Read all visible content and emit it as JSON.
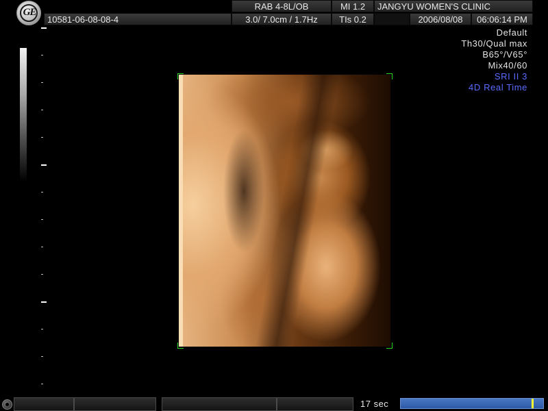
{
  "header": {
    "logo": "GE",
    "patient_id": "10581-06-08-08-4",
    "probe": "RAB 4-8L/OB",
    "depth_freq": "3.0/ 7.0cm / 1.7Hz",
    "mi": "MI  1.2",
    "tis": "TIs  0.2",
    "institution": "JANGYU WOMEN'S CLINIC",
    "date": "2006/08/08",
    "time": "06:06:14 PM"
  },
  "params": {
    "preset": "Default",
    "threshold_quality": "Th30/Qual max",
    "angles": "B65°/V65°",
    "mix": "Mix40/60",
    "sri": "SRI II 3",
    "mode": "4D Real Time"
  },
  "bottom": {
    "timer": "17 sec",
    "cine_position": 0.93
  },
  "colors": {
    "accent_blue": "#5a6cff",
    "roi_green": "#2bd32b",
    "cine_bar": "#3a68b8",
    "cine_marker": "#ffff33"
  }
}
